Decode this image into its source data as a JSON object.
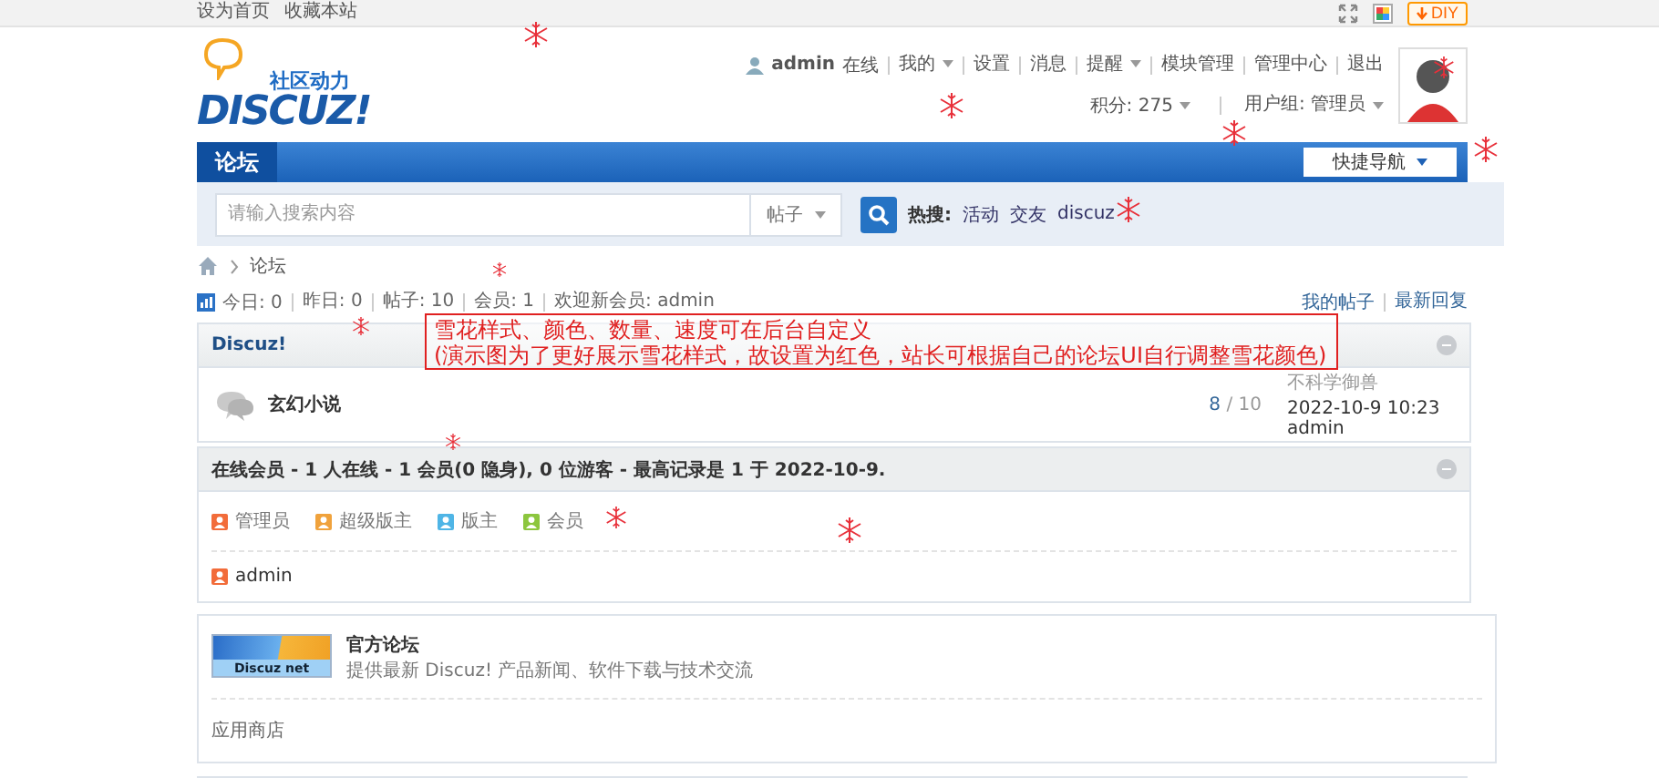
{
  "topbar": {
    "links": [
      "设为首页",
      "收藏本站"
    ],
    "diy": "DIY"
  },
  "header": {
    "logo_tagline": "社区动力",
    "logo_text": "DISCUZ!",
    "user": {
      "name": "admin",
      "status": "在线"
    },
    "menu": [
      {
        "label": "我的",
        "dropdown": true
      },
      {
        "label": "设置",
        "dropdown": false
      },
      {
        "label": "消息",
        "dropdown": false
      },
      {
        "label": "提醒",
        "dropdown": true
      },
      {
        "label": "模块管理",
        "dropdown": false
      },
      {
        "label": "管理中心",
        "dropdown": false
      },
      {
        "label": "退出",
        "dropdown": false
      }
    ],
    "credits": "积分: 275",
    "group": "用户组: 管理员"
  },
  "nav": {
    "items": [
      {
        "label": "论坛",
        "selected": true
      }
    ],
    "quick_nav": "快捷导航"
  },
  "search": {
    "placeholder": "请输入搜索内容",
    "type": "帖子",
    "hot_label": "热搜:",
    "hot": [
      "活动",
      "交友",
      "discuz"
    ]
  },
  "breadcrumb": [
    "论坛"
  ],
  "stats": {
    "items": [
      "今日: 0",
      "昨日: 0",
      "帖子: 10",
      "会员: 1",
      "欢迎新会员: admin"
    ],
    "links": [
      "我的帖子",
      "最新回复"
    ]
  },
  "notice": {
    "lines": [
      "雪花样式、颜色、数量、速度可在后台自定义",
      "(演示图为了更好展示雪花样式，故设置为红色，站长可根据自己的论坛UI自行调整雪花颜色)"
    ]
  },
  "category": {
    "title": "Discuz!",
    "forums": [
      {
        "name": "玄幻小说",
        "threads": "8",
        "posts": "/ 10",
        "last_title": "不科学御兽",
        "last_time": "2022-10-9 10:23",
        "last_user": "admin"
      }
    ]
  },
  "online": {
    "title": "在线会员 - 1 人在线 - 1 会员(0 隐身), 0 位游客 - 最高记录是 1 于 2022-10-9.",
    "legend": [
      {
        "label": "管理员",
        "color": "#f26c3a"
      },
      {
        "label": "超级版主",
        "color": "#f0a23c"
      },
      {
        "label": "版主",
        "color": "#4fb5e6"
      },
      {
        "label": "会员",
        "color": "#8cc63e"
      }
    ],
    "members": [
      {
        "name": "admin",
        "color": "#f26c3a"
      }
    ]
  },
  "links": {
    "sites": [
      {
        "name": "官方论坛",
        "desc": "提供最新 Discuz! 产品新闻、软件下载与技术交流",
        "logo_text": "Discuz net"
      }
    ],
    "text_links": [
      "应用商店"
    ]
  }
}
